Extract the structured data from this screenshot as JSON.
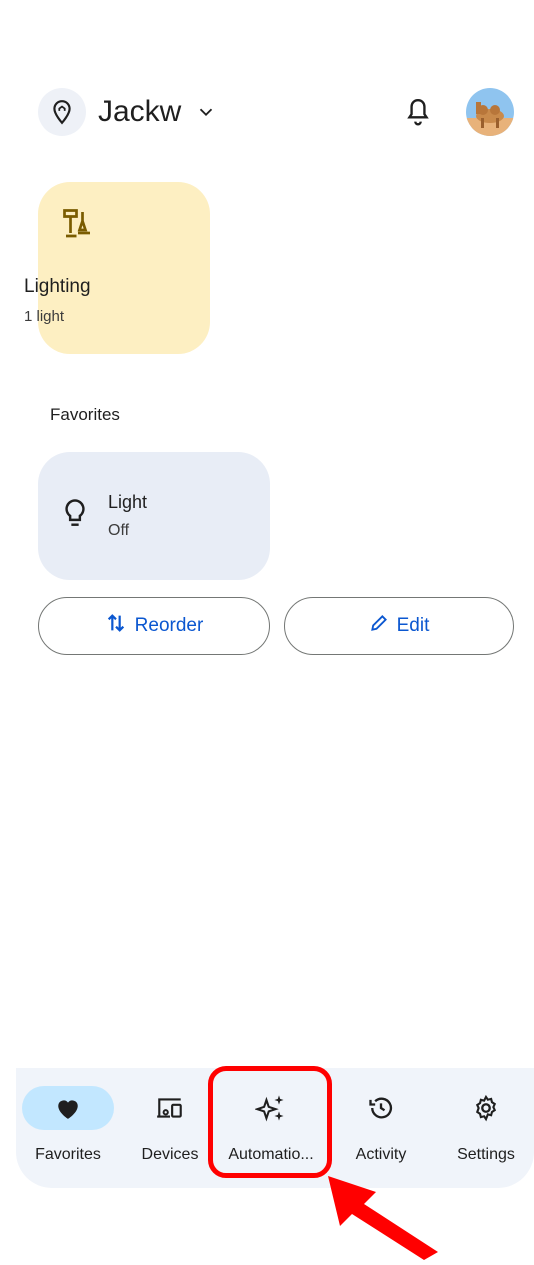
{
  "header": {
    "home_name": "Jackw"
  },
  "spaces": [
    {
      "title": "Lighting",
      "subtitle": "1 light"
    }
  ],
  "favorites": {
    "section_label": "Favorites",
    "devices": [
      {
        "name": "Light",
        "state": "Off"
      }
    ],
    "reorder_label": "Reorder",
    "edit_label": "Edit"
  },
  "nav": {
    "items": [
      {
        "label": "Favorites",
        "icon": "heart-icon",
        "active": true
      },
      {
        "label": "Devices",
        "icon": "devices-icon",
        "active": false
      },
      {
        "label": "Automatio...",
        "icon": "sparkle-icon",
        "active": false
      },
      {
        "label": "Activity",
        "icon": "history-icon",
        "active": false
      },
      {
        "label": "Settings",
        "icon": "gear-icon",
        "active": false
      }
    ]
  },
  "colors": {
    "accent": "#0b57d0",
    "space_card_bg": "#fdefc2",
    "device_tile_bg": "#e8edf6",
    "nav_bg": "#f0f4fa",
    "nav_active": "#c2e7ff",
    "annotation": "#ff0000"
  }
}
